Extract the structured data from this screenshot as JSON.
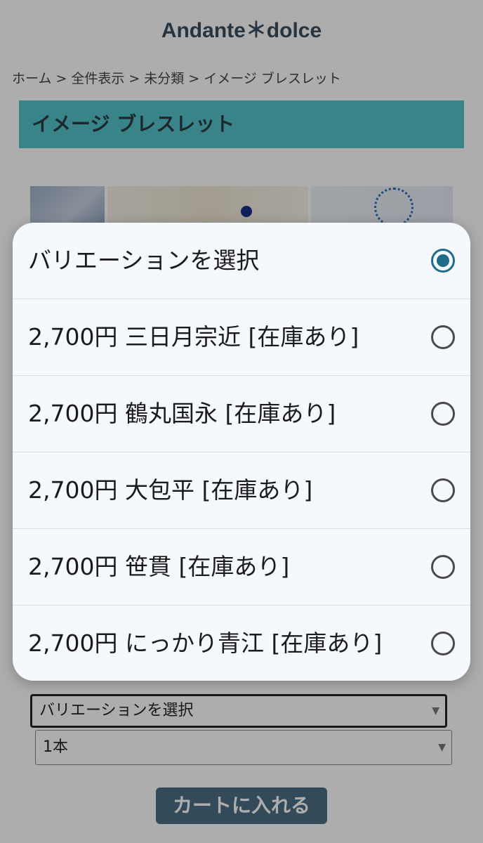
{
  "site": {
    "title": "Andante＊dolce"
  },
  "breadcrumb": [
    "ホーム",
    "全件表示",
    "未分類",
    "イメージ ブレスレット"
  ],
  "breadcrumb_sep": ">",
  "product": {
    "title": "イメージ ブレスレット"
  },
  "form": {
    "variation_select_value": "バリエーションを選択",
    "quantity_select_value": "1本",
    "cart_button_label": "カートに入れる"
  },
  "dialog": {
    "options": [
      {
        "label": "バリエーションを選択",
        "selected": true
      },
      {
        "label": "2,700円 三日月宗近 [在庫あり]",
        "selected": false
      },
      {
        "label": "2,700円 鶴丸国永 [在庫あり]",
        "selected": false
      },
      {
        "label": "2,700円 大包平 [在庫あり]",
        "selected": false
      },
      {
        "label": "2,700円 笹貫 [在庫あり]",
        "selected": false
      },
      {
        "label": "2,700円 にっかり青江 [在庫あり]",
        "selected": false
      }
    ]
  },
  "colors": {
    "title_bar": "#53c3c9",
    "radio_selected": "#1f6b8a",
    "cart_button": "#4b6e85",
    "dialog_bg": "#f5f8fd"
  }
}
